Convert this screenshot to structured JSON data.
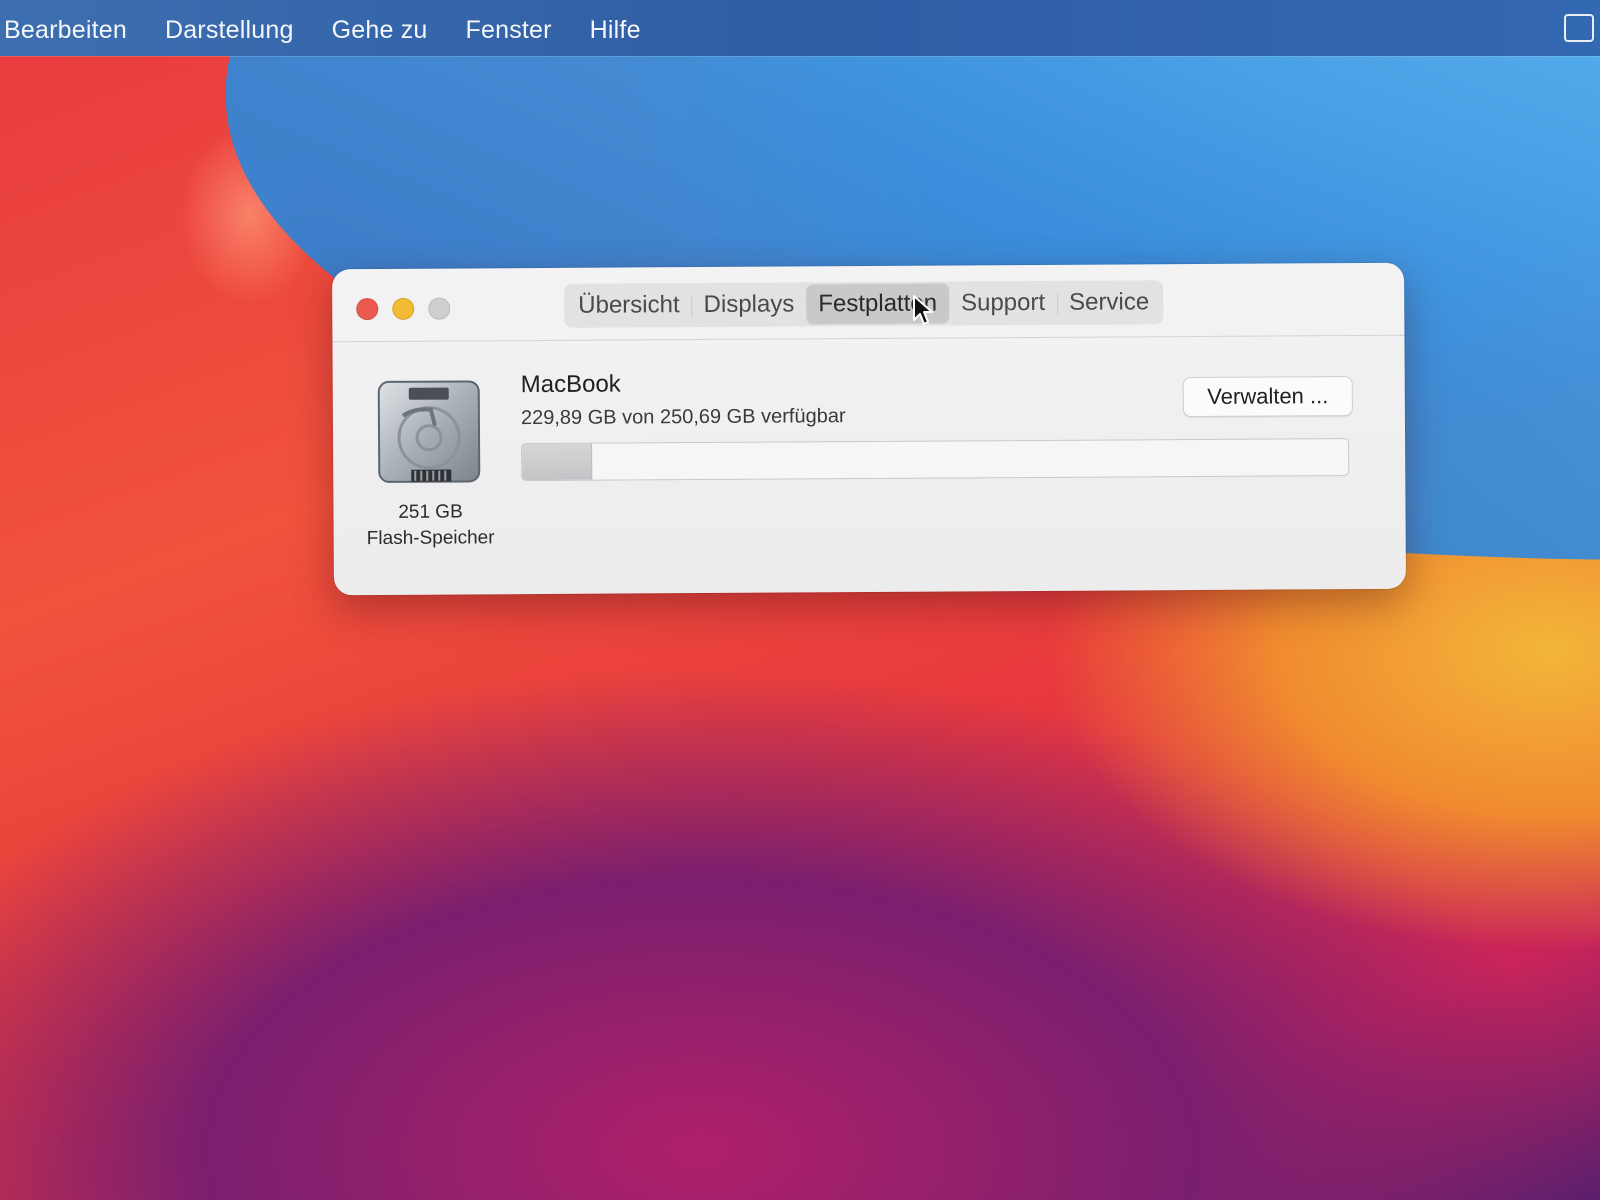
{
  "menubar": {
    "items": [
      "Bearbeiten",
      "Darstellung",
      "Gehe zu",
      "Fenster",
      "Hilfe"
    ]
  },
  "window": {
    "tabs": [
      "Übersicht",
      "Displays",
      "Festplatten",
      "Support",
      "Service"
    ],
    "active_tab": "Festplatten",
    "disk": {
      "size": "251 GB",
      "type": "Flash-Speicher",
      "icon": "hard-drive-icon"
    },
    "volume": {
      "name": "MacBook",
      "free_text": "229,89 GB von 250,69 GB verfügbar",
      "used_fraction": 0.083
    },
    "manage_button": "Verwalten ..."
  },
  "colors": {
    "close": "#ec5a4f",
    "minimize": "#f2bb34",
    "zoom": "#cfcfd1"
  }
}
